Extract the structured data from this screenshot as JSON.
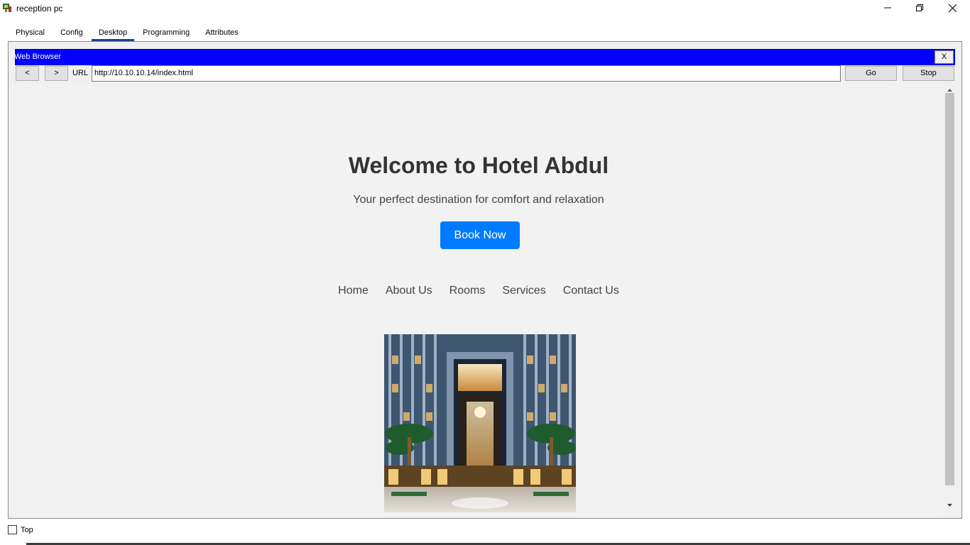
{
  "window": {
    "title": "reception pc",
    "controls": {
      "minimize_icon": "minimize-icon",
      "restore_icon": "restore-icon",
      "close_icon": "close-icon"
    }
  },
  "tabs": [
    {
      "label": "Physical"
    },
    {
      "label": "Config"
    },
    {
      "label": "Desktop",
      "active": true
    },
    {
      "label": "Programming"
    },
    {
      "label": "Attributes"
    }
  ],
  "browser": {
    "title": "Web Browser",
    "close_label": "X",
    "back_label": "<",
    "forward_label": ">",
    "url_label": "URL",
    "url_value": "http://10.10.10.14/index.html",
    "go_label": "Go",
    "stop_label": "Stop",
    "titlebar_color": "#0000ff"
  },
  "page": {
    "headline": "Welcome to Hotel Abdul",
    "tagline": "Your perfect destination for comfort and relaxation",
    "cta_label": "Book Now",
    "cta_color": "#007bff",
    "nav": [
      "Home",
      "About Us",
      "Rooms",
      "Services",
      "Contact Us"
    ]
  },
  "footer": {
    "top_label": "Top",
    "top_checked": false
  }
}
